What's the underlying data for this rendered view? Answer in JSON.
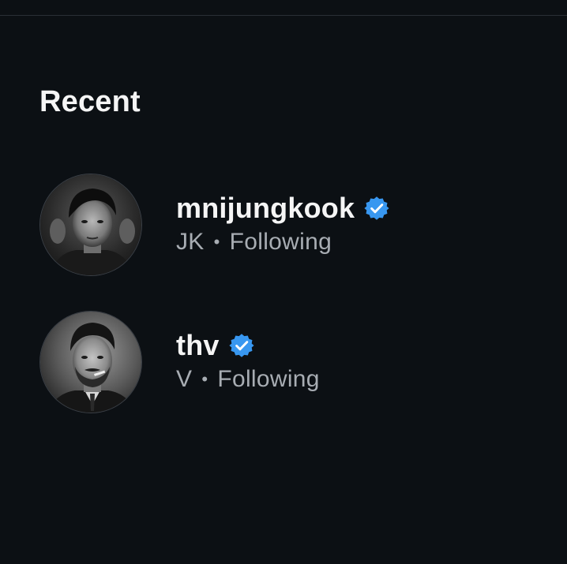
{
  "section": {
    "title": "Recent"
  },
  "results": [
    {
      "username": "mnijungkook",
      "display_name": "JK",
      "relation": "Following",
      "verified": true,
      "avatar_icon": "user-avatar-photo"
    },
    {
      "username": "thv",
      "display_name": "V",
      "relation": "Following",
      "verified": true,
      "avatar_icon": "user-avatar-photo"
    }
  ],
  "colors": {
    "background": "#0c1014",
    "primary_text": "#f5f5f5",
    "secondary_text": "#a8adb3",
    "verified_blue": "#3897f0"
  }
}
